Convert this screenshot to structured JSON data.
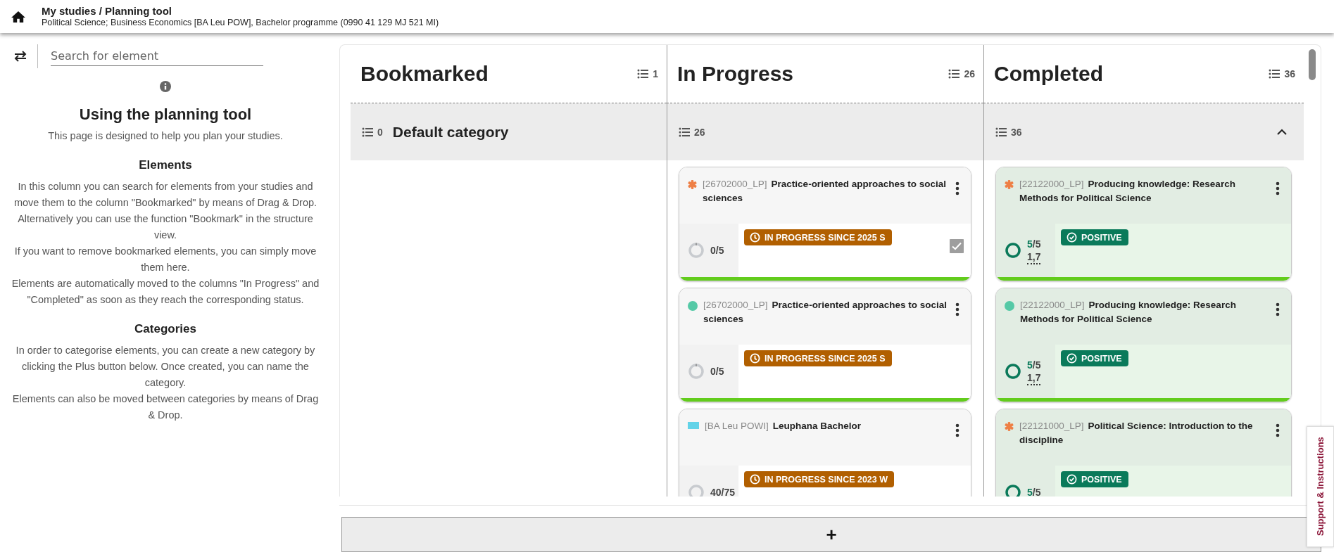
{
  "header": {
    "title": "My studies / Planning tool",
    "subtitle": "Political Science; Business Economics [BA Leu POW], Bachelor programme (0990 41 129 MJ 521 MI)"
  },
  "sidebar": {
    "search": {
      "placeholder": "Search for element"
    },
    "heading": "Using the planning tool",
    "intro": "This page is designed to help you plan your studies.",
    "sections": [
      {
        "heading": "Elements",
        "paragraphs": [
          "In this column you can search for elements from your studies and move them to the column \"Bookmarked\" by means of Drag & Drop. Alternatively you can use the function \"Bookmark\" in the structure view.",
          "If you want to remove bookmarked elements, you can simply move them here.",
          "Elements are automatically moved to the columns \"In Progress\" and \"Completed\" as soon as they reach the corresponding status."
        ]
      },
      {
        "heading": "Categories",
        "paragraphs": [
          "In order to categorise elements, you can create a new category by clicking the Plus button below. Once created, you can name the category.",
          "Elements can also be moved between categories by means of Drag & Drop."
        ]
      }
    ]
  },
  "board": {
    "columns": [
      {
        "title": "Bookmarked",
        "count": "1"
      },
      {
        "title": "In Progress",
        "count": "26"
      },
      {
        "title": "Completed",
        "count": "36"
      }
    ],
    "category": {
      "name": "Default category",
      "expanded": true,
      "lanes": [
        {
          "count": "0"
        },
        {
          "count": "26",
          "cards": [
            {
              "kind": "star",
              "code": "[26702000_LP]",
              "title": "Practice-oriented approaches to social sciences",
              "level": 0,
              "credits_done": "0",
              "credits_total": "/5",
              "badge": {
                "kind": "in_progress",
                "label": "IN PROGRESS SINCE 2025 S"
              },
              "checked": true
            },
            {
              "kind": "dot",
              "code": "[26702000_LP]",
              "title": "Practice-oriented approaches to social sciences",
              "level": 0,
              "credits_done": "0",
              "credits_total": "/5",
              "badge": {
                "kind": "in_progress",
                "label": "IN PROGRESS SINCE 2025 S"
              }
            },
            {
              "kind": "bar",
              "code": "[BA Leu POWI]",
              "title": "Leuphana Bachelor",
              "credits_done": "40",
              "credits_total": "/75",
              "badge": {
                "kind": "in_progress",
                "label": "IN PROGRESS SINCE 2023 W"
              }
            }
          ]
        },
        {
          "count": "36",
          "cards": [
            {
              "kind": "star",
              "code": "[22122000_LP]",
              "title": "Producing knowledge: Research Methods for Political Science",
              "level": 1,
              "credits_done": "5",
              "credits_total": "/5",
              "grade": "1,7",
              "badge": {
                "kind": "positive",
                "label": "POSITIVE"
              }
            },
            {
              "kind": "dot",
              "code": "[22122000_LP]",
              "title": "Producing knowledge: Research Methods for Political Science",
              "level": 1,
              "credits_done": "5",
              "credits_total": "/5",
              "grade": "1,7",
              "badge": {
                "kind": "positive",
                "label": "POSITIVE"
              }
            },
            {
              "kind": "star",
              "code": "[22121000_LP]",
              "title": "Political Science: Introduction to the discipline",
              "credits_done": "5",
              "credits_total": "/5",
              "badge": {
                "kind": "positive",
                "label": "POSITIVE"
              }
            }
          ]
        }
      ]
    }
  },
  "add_button": "+",
  "support_tab": "Support & Instructions"
}
